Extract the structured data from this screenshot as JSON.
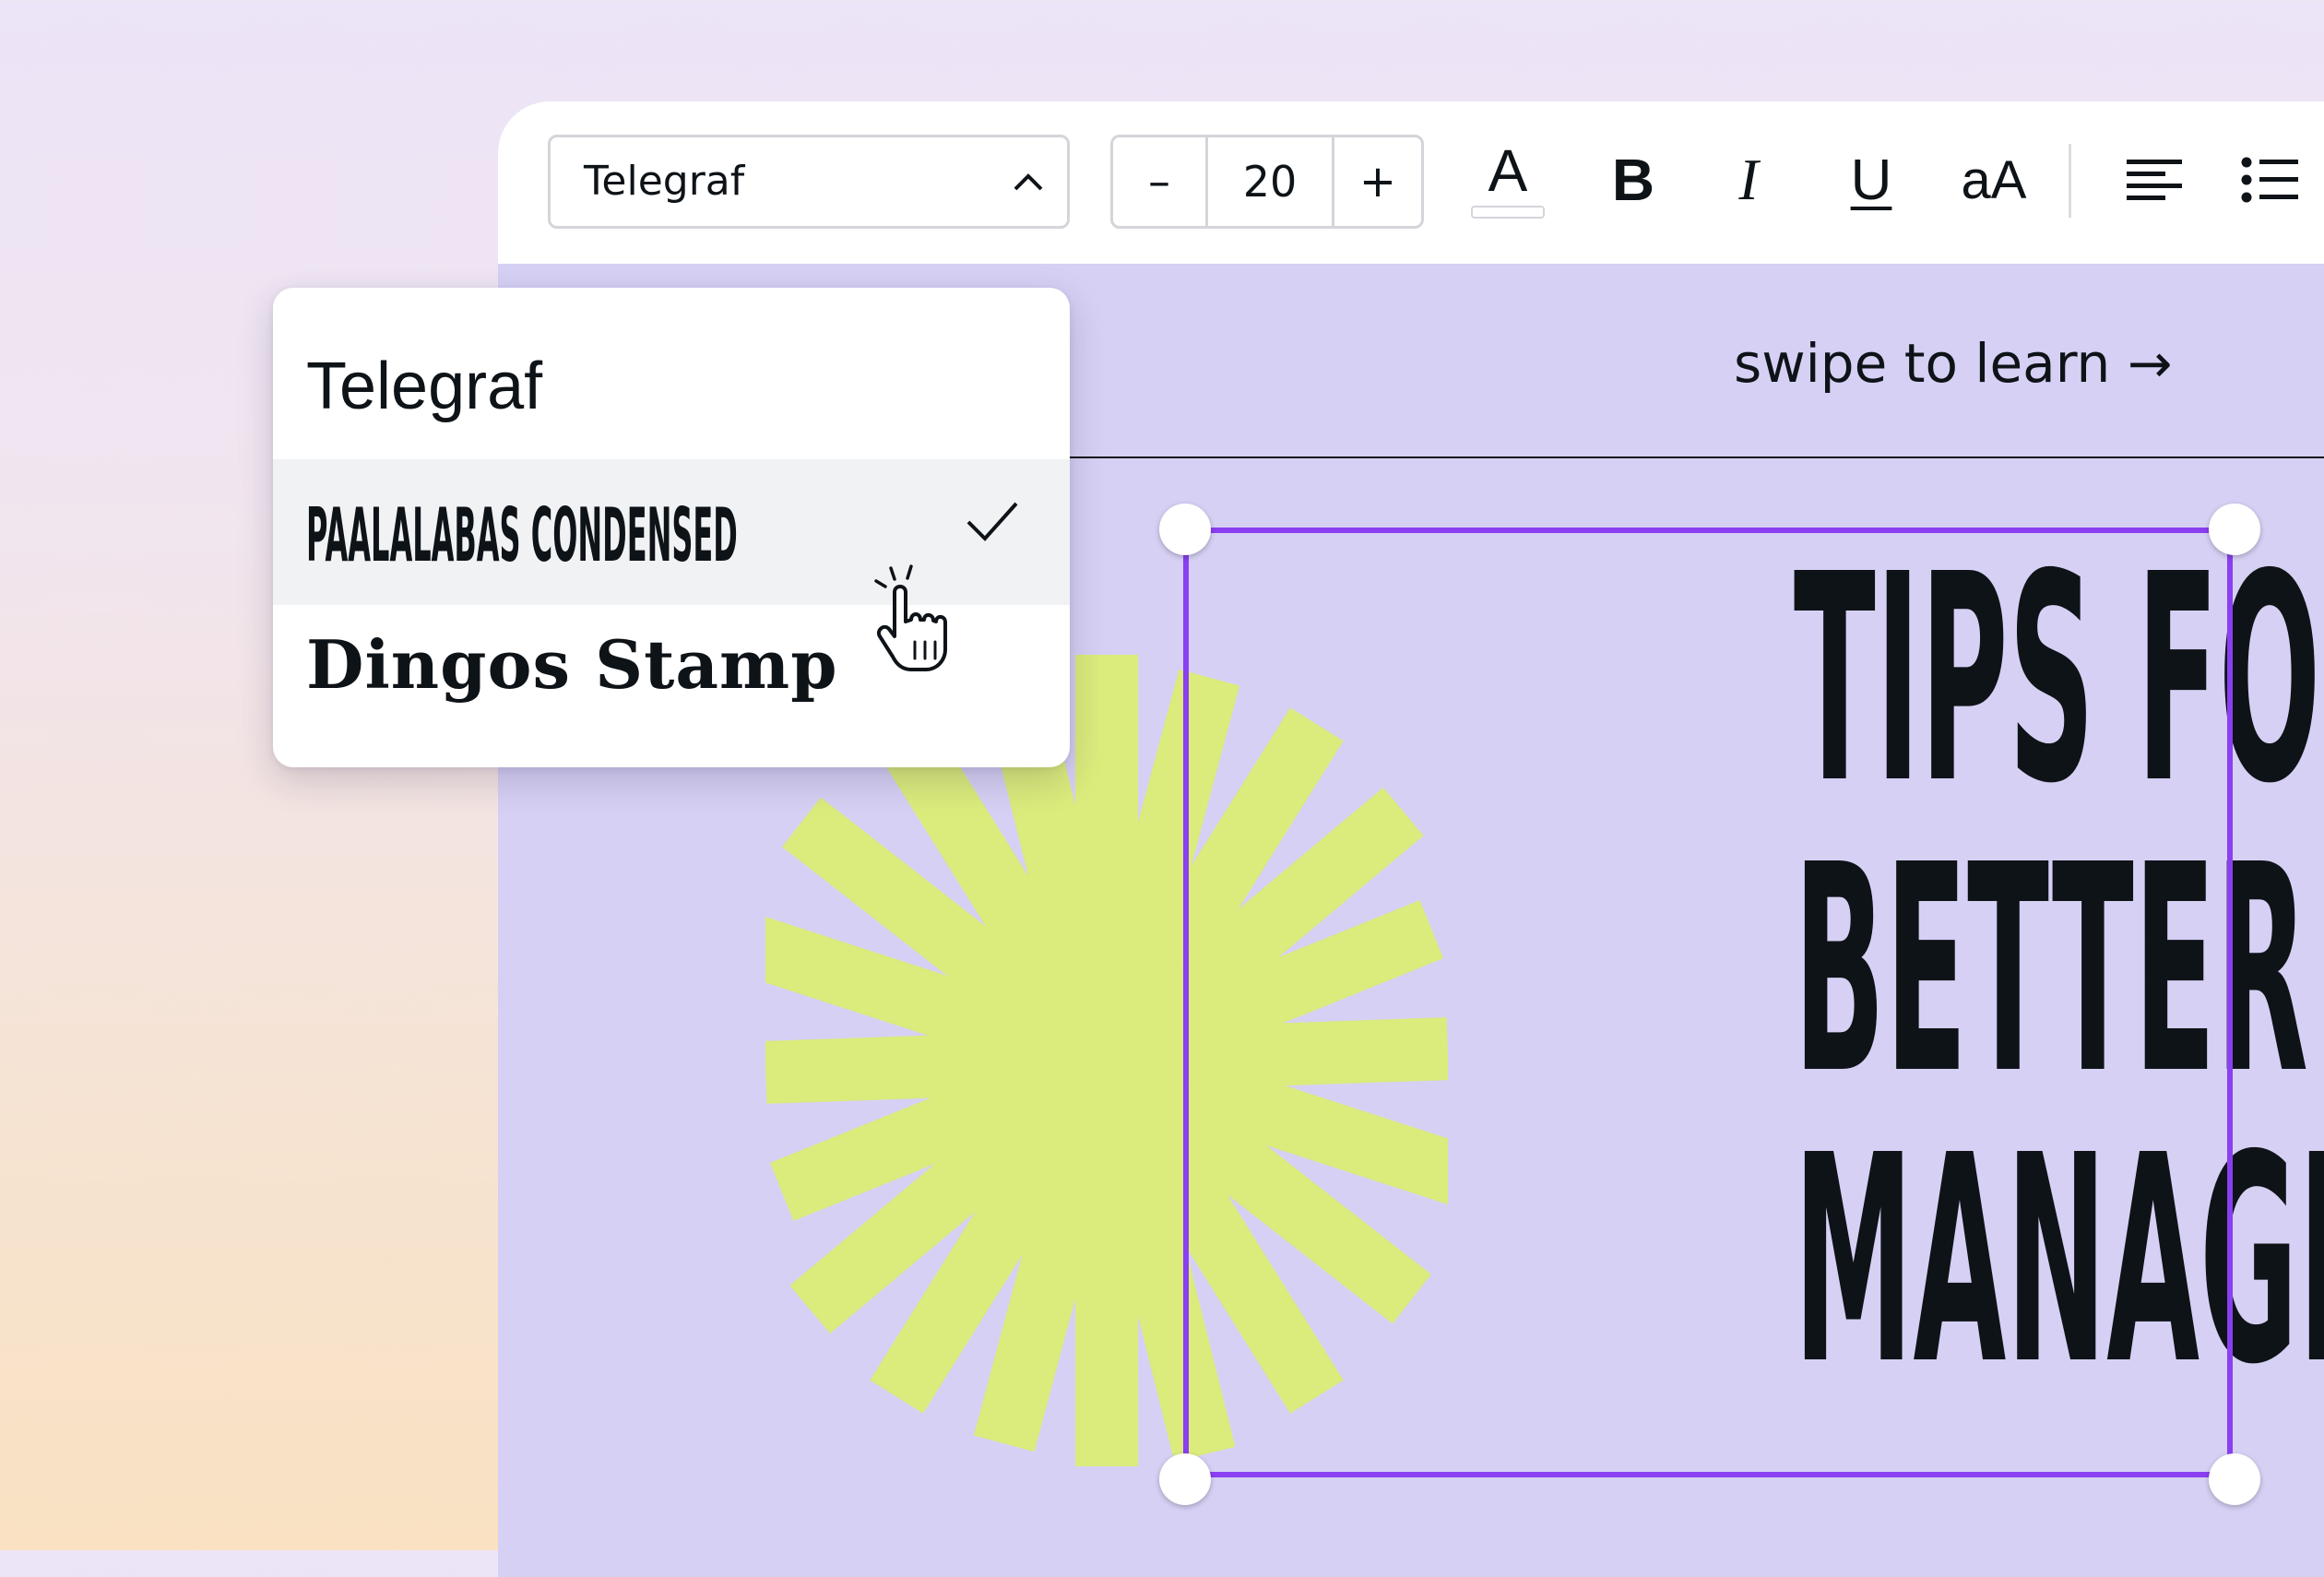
{
  "toolbar": {
    "font_name": "Telegraf",
    "font_size": "20",
    "minus_label": "–",
    "plus_label": "+",
    "color_label": "A",
    "bold_label": "B",
    "italic_label": "I",
    "underline_label": "U",
    "case_label": "aA"
  },
  "canvas": {
    "swipe_text": "swipe to learn →",
    "headline": [
      "TIPS FOR",
      "BETTER TIME",
      "MANAGEMENT"
    ],
    "accent_color": "#dbeb7c",
    "selection_color": "#8a3ff0",
    "background_color": "#d6d0f4"
  },
  "font_dropdown": {
    "options": [
      "Telegraf",
      "PAALALABAS CONDENSED",
      "Dingos Stamp"
    ],
    "selected_index": 1
  }
}
